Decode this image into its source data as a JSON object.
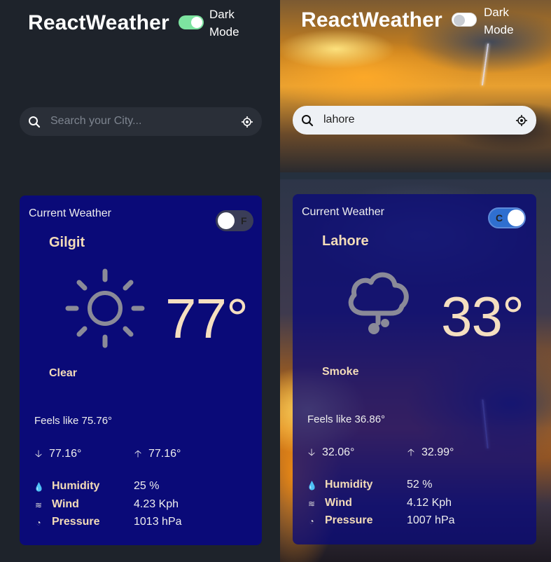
{
  "app_title": "ReactWeather",
  "dark_mode_label_line1": "Dark",
  "dark_mode_label_line2": "Mode",
  "left": {
    "dark_mode_on": true,
    "search": {
      "placeholder": "Search your City...",
      "value": ""
    },
    "card": {
      "heading": "Current Weather",
      "unit_label": "F",
      "city": "Gilgit",
      "temperature": "77°",
      "condition": "Clear",
      "icon": "sun-icon",
      "feels_like": "Feels like 75.76°",
      "min": "77.16°",
      "max": "77.16°",
      "humidity_label": "Humidity",
      "humidity_value": "25  %",
      "wind_label": "Wind",
      "wind_value": "4.23  Kph",
      "pressure_label": "Pressure",
      "pressure_value": "1013  hPa"
    }
  },
  "right": {
    "dark_mode_on": false,
    "search": {
      "placeholder": "Search your City...",
      "value": "lahore"
    },
    "card": {
      "heading": "Current Weather",
      "unit_label": "C",
      "city": "Lahore",
      "temperature": "33°",
      "condition": "Smoke",
      "icon": "cloud-hail-icon",
      "feels_like": "Feels like 36.86°",
      "min": "32.06°",
      "max": "32.99°",
      "humidity_label": "Humidity",
      "humidity_value": "52  %",
      "wind_label": "Wind",
      "wind_value": "4.12  Kph",
      "pressure_label": "Pressure",
      "pressure_value": "1007  hPa"
    }
  },
  "colors": {
    "dark_bg": "#1e232b",
    "card": "#0a0a78",
    "accent_toggle": "#7de3a0",
    "unit_toggle_on": "#2f6fd0",
    "warm_text": "#f3dcb8"
  }
}
